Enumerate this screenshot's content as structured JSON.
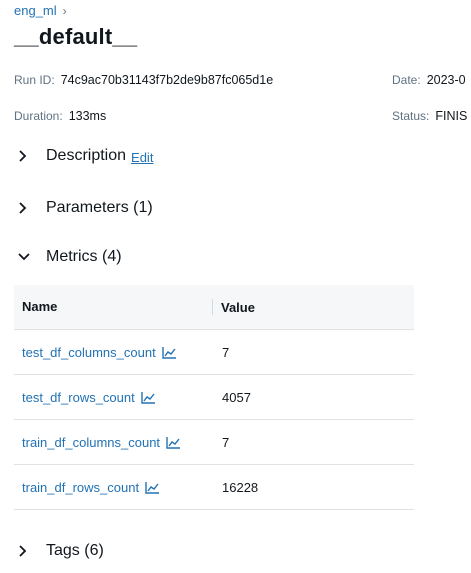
{
  "breadcrumb": {
    "experiment": "eng_ml",
    "separator": "›"
  },
  "page_title": "__default__",
  "meta": {
    "run_id_label": "Run ID:",
    "run_id": "74c9ac70b31143f7b2de9b87fc065d1e",
    "date_label": "Date:",
    "date_value": "2023-0",
    "duration_label": "Duration:",
    "duration": "133ms",
    "status_label": "Status:",
    "status_value": "FINIS"
  },
  "sections": {
    "description": {
      "title": "Description",
      "edit_label": "Edit"
    },
    "parameters": {
      "title": "Parameters (1)"
    },
    "metrics": {
      "title": "Metrics (4)"
    },
    "tags": {
      "title": "Tags (6)"
    }
  },
  "metrics_table": {
    "headers": {
      "name": "Name",
      "value": "Value"
    },
    "rows": [
      {
        "name": "test_df_columns_count",
        "value": "7"
      },
      {
        "name": "test_df_rows_count",
        "value": "4057"
      },
      {
        "name": "train_df_columns_count",
        "value": "7"
      },
      {
        "name": "train_df_rows_count",
        "value": "16228"
      }
    ]
  },
  "colors": {
    "link": "#2272b4",
    "header_bg": "#f6f7f9",
    "border": "#e0e3e6"
  }
}
